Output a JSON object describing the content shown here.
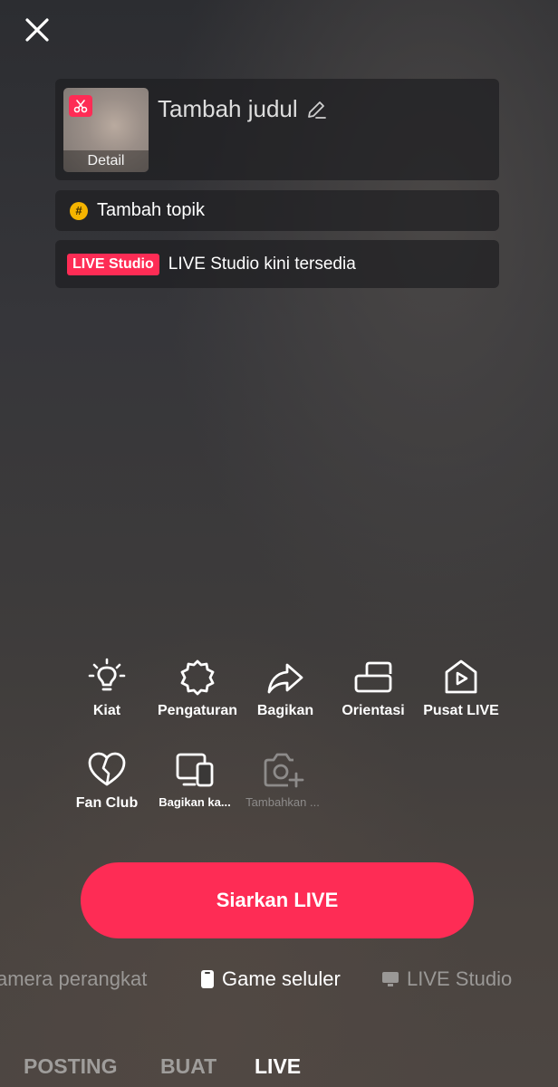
{
  "header": {
    "close_icon": "close-icon"
  },
  "title_card": {
    "thumbnail_badge_icon": "scissors-icon",
    "detail_label": "Detail",
    "title_placeholder": "Tambah judul",
    "edit_icon": "pencil-icon"
  },
  "topic": {
    "icon": "hashtag-icon",
    "label": "Tambah topik"
  },
  "studio": {
    "badge": "LIVE Studio",
    "text": "LIVE Studio kini tersedia"
  },
  "tools": {
    "row1": [
      {
        "label": "Kiat",
        "icon": "lightbulb-icon"
      },
      {
        "label": "Pengaturan",
        "icon": "gear-icon"
      },
      {
        "label": "Bagikan",
        "icon": "share-icon"
      },
      {
        "label": "Orientasi",
        "icon": "orientation-icon"
      },
      {
        "label": "Pusat LIVE",
        "icon": "live-center-icon"
      }
    ],
    "row2": [
      {
        "label": "Fan Club",
        "icon": "heart-icon"
      },
      {
        "label": "Bagikan ka...",
        "icon": "devices-icon"
      },
      {
        "label": "Tambahkan ...",
        "icon": "camera-add-icon"
      }
    ]
  },
  "go_live_label": "Siarkan LIVE",
  "modes": [
    {
      "label": "amera perangkat"
    },
    {
      "label": "Game seluler",
      "icon": "phone-icon"
    },
    {
      "label": "LIVE Studio",
      "icon": "monitor-icon"
    }
  ],
  "tabs": [
    "POSTING",
    "BUAT",
    "LIVE"
  ],
  "colors": {
    "accent": "#fe2c55",
    "topic_badge": "#f5b400"
  }
}
